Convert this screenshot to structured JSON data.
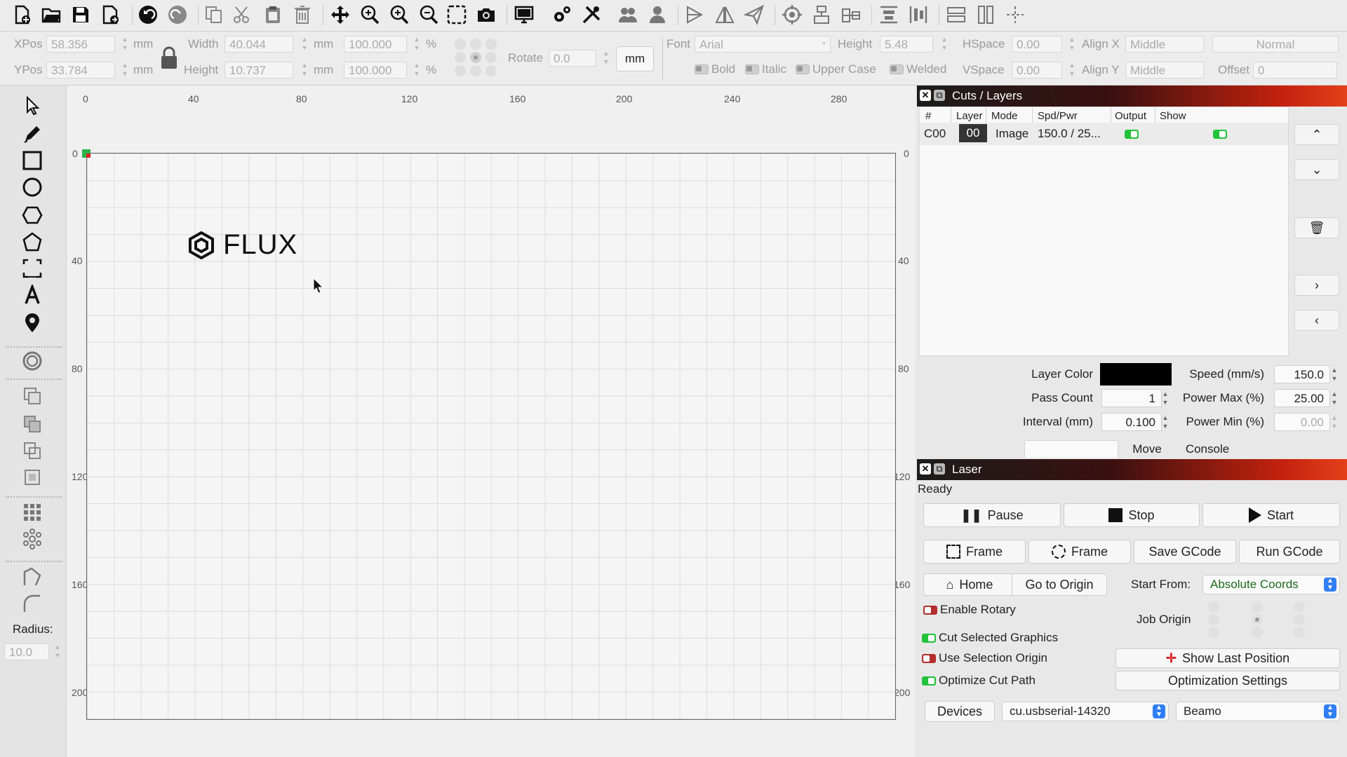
{
  "toolbar": {
    "icons": [
      "new-file-icon",
      "open-folder-icon",
      "save-icon",
      "save-as-icon",
      "undo-icon",
      "redo-icon",
      "copy-icon",
      "cut-icon",
      "paste-icon",
      "delete-icon",
      "move-icon",
      "zoom-in-icon",
      "zoom-in-alt-icon",
      "zoom-out-icon",
      "select-area-icon",
      "camera-icon",
      "monitor-icon",
      "settings-gears-icon",
      "tools-icon",
      "group-icon",
      "ungroup-icon",
      "flip-horizontal-icon",
      "flip-vertical-icon",
      "send-icon",
      "target-icon",
      "align-top-icon",
      "align-center-icon",
      "distribute-icon",
      "distribute-vertical-icon",
      "same-size-icon",
      "same-size-vertical-icon",
      "crosshair-icon"
    ]
  },
  "props": {
    "xpos_label": "XPos",
    "xpos_value": "58.356",
    "ypos_label": "YPos",
    "ypos_value": "33.784",
    "unit": "mm",
    "width_label": "Width",
    "width_value": "40.044",
    "height_label": "Height",
    "height_value": "10.737",
    "scale_w": "100.000",
    "scale_h": "100.000",
    "percent": "%",
    "rotate_label": "Rotate",
    "rotate_value": "0.0",
    "unit_button": "mm",
    "font_label": "Font",
    "font_value": "Arial",
    "text_height_label": "Height",
    "text_height_value": "5.48",
    "hspace_label": "HSpace",
    "hspace_value": "0.00",
    "vspace_label": "VSpace",
    "vspace_value": "0.00",
    "alignx_label": "Align X",
    "alignx_value": "Middle",
    "aligny_label": "Align Y",
    "aligny_value": "Middle",
    "style_value": "Normal",
    "offset_label": "Offset",
    "offset_value": "0",
    "bold": "Bold",
    "italic": "Italic",
    "upper_case": "Upper Case",
    "welded": "Welded"
  },
  "toolbox": {
    "icons": [
      "select-arrow-icon",
      "pen-icon",
      "rectangle-icon",
      "circle-icon",
      "hexagon-icon",
      "polygon-icon",
      "rect-mark-icon",
      "text-icon",
      "location-pin-icon",
      "offset-ring-icon",
      "copy-shape-icon",
      "boolean-union-icon",
      "boolean-diff-icon",
      "boolean-intersect-icon",
      "grid-array-icon",
      "circular-array-icon",
      "corner-icon",
      "fillet-icon"
    ],
    "radius_label": "Radius:",
    "radius_value": "10.0"
  },
  "ruler": {
    "top": [
      "0",
      "40",
      "80",
      "120",
      "160",
      "200",
      "240",
      "280"
    ],
    "left": [
      "0",
      "40",
      "80",
      "120",
      "160",
      "200"
    ],
    "right": [
      "0",
      "40",
      "80",
      "120",
      "160",
      "200"
    ]
  },
  "canvas": {
    "logo_text": "FLUX"
  },
  "cuts_panel": {
    "title": "Cuts / Layers",
    "columns": [
      "#",
      "Layer",
      "Mode",
      "Spd/Pwr",
      "Output",
      "Show"
    ],
    "rows": [
      {
        "id": "C00",
        "layer": "00",
        "mode": "Image",
        "spd_pwr": "150.0 / 25...",
        "output": true,
        "show": true
      }
    ],
    "layer_color_label": "Layer Color",
    "layer_color": "#000000",
    "speed_label": "Speed (mm/s)",
    "speed_value": "150.0",
    "pass_count_label": "Pass Count",
    "pass_count_value": "1",
    "power_max_label": "Power Max (%)",
    "power_max_value": "25.00",
    "interval_label": "Interval (mm)",
    "interval_value": "0.100",
    "power_min_label": "Power Min (%)",
    "power_min_value": "0.00",
    "tabs": [
      "",
      "Move",
      "Console"
    ]
  },
  "laser_panel": {
    "title": "Laser",
    "status": "Ready",
    "pause": "Pause",
    "stop": "Stop",
    "start": "Start",
    "frame1": "Frame",
    "frame2": "Frame",
    "save_gcode": "Save GCode",
    "run_gcode": "Run GCode",
    "home": "Home",
    "go_to_origin": "Go to Origin",
    "start_from_label": "Start From:",
    "start_from_value": "Absolute Coords",
    "enable_rotary": "Enable Rotary",
    "job_origin": "Job Origin",
    "cut_selected": "Cut Selected Graphics",
    "use_selection_origin": "Use Selection Origin",
    "optimize_cut_path": "Optimize Cut Path",
    "show_last_position": "Show Last Position",
    "optimization_settings": "Optimization Settings",
    "devices": "Devices",
    "port": "cu.usbserial-14320",
    "machine": "Beamo"
  }
}
